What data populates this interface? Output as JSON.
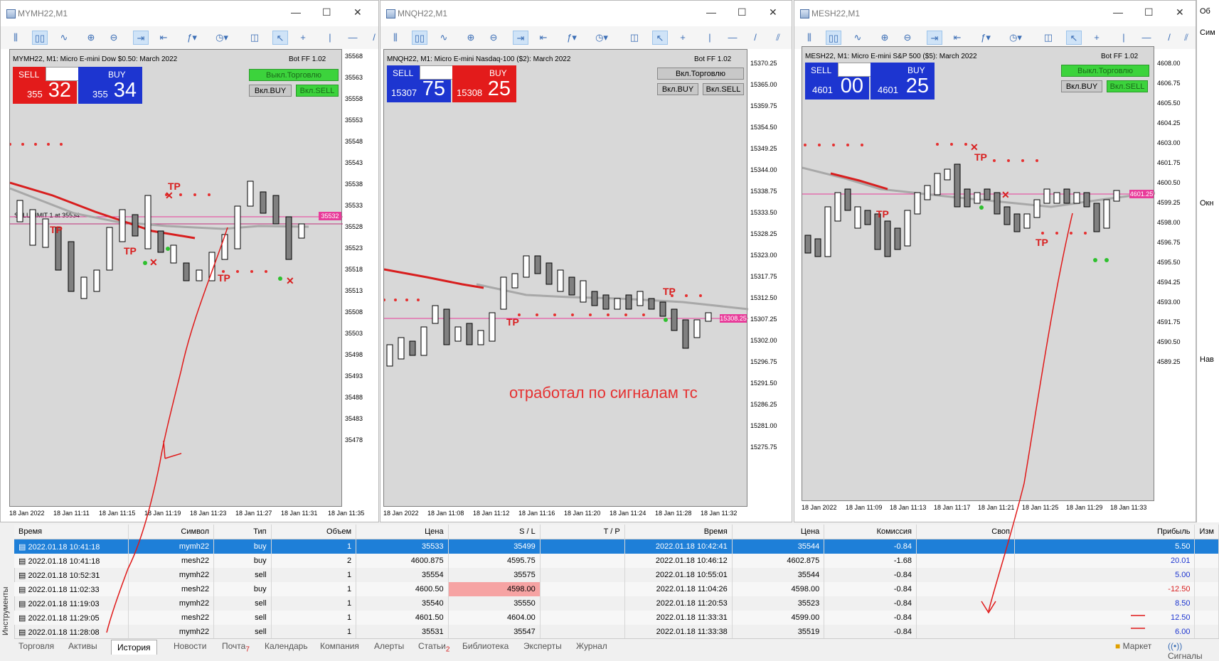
{
  "windows": [
    {
      "title": "MYMH22,M1",
      "header": "MYMH22, M1:  Micro E-mini Dow $0.50: March 2022",
      "bot": "Bot FF 1.02",
      "sell_label": "SELL",
      "buy_label": "BUY",
      "lot": "1",
      "sell_small": "355",
      "sell_big": "32",
      "buy_small": "355",
      "buy_big": "34",
      "btn_trade": "Выкл.Торговлю",
      "btn_buy": "Вкл.BUY",
      "btn_sell": "Вкл.SELL",
      "price_tag": "35532",
      "order_line": "SELL LIMIT 1 at 35534",
      "yticks": [
        "35568",
        "35563",
        "35558",
        "35553",
        "35548",
        "35543",
        "35538",
        "35533",
        "35528",
        "35523",
        "35518",
        "35513",
        "35508",
        "35503",
        "35498",
        "35493",
        "35488",
        "35483",
        "35478"
      ],
      "xticks": [
        "18 Jan 2022",
        "18 Jan 11:11",
        "18 Jan 11:15",
        "18 Jan 11:19",
        "18 Jan 11:23",
        "18 Jan 11:27",
        "18 Jan 11:31",
        "18 Jan 11:35"
      ]
    },
    {
      "title": "MNQH22,M1",
      "header": "MNQH22, M1:  Micro E-mini Nasdaq-100 ($2): March 2022",
      "bot": "Bot FF 1.02",
      "sell_label": "SELL",
      "buy_label": "BUY",
      "lot": "1",
      "sell_small": "15307",
      "sell_big": "75",
      "buy_small": "15308",
      "buy_big": "25",
      "btn_trade": "Вкл.Торговлю",
      "btn_buy": "Вкл.BUY",
      "btn_sell": "Вкл.SELL",
      "price_tag": "15308.25",
      "yticks": [
        "15370.25",
        "15365.00",
        "15359.75",
        "15354.50",
        "15349.25",
        "15344.00",
        "15338.75",
        "15333.50",
        "15328.25",
        "15323.00",
        "15317.75",
        "15312.50",
        "15307.25",
        "15302.00",
        "15296.75",
        "15291.50",
        "15286.25",
        "15281.00",
        "15275.75"
      ],
      "xticks": [
        "18 Jan 2022",
        "18 Jan 11:08",
        "18 Jan 11:12",
        "18 Jan 11:16",
        "18 Jan 11:20",
        "18 Jan 11:24",
        "18 Jan 11:28",
        "18 Jan 11:32"
      ]
    },
    {
      "title": "MESH22,M1",
      "header": "MESH22, M1:  Micro E-mini S&P 500 ($5): March 2022",
      "bot": "Bot FF 1.02",
      "sell_label": "SELL",
      "buy_label": "BUY",
      "lot": "1",
      "sell_small": "4601",
      "sell_big": "00",
      "buy_small": "4601",
      "buy_big": "25",
      "btn_trade": "Выкл.Торговлю",
      "btn_buy": "Вкл.BUY",
      "btn_sell": "Вкл.SELL",
      "price_tag": "4601.25",
      "yticks": [
        "4608.00",
        "4606.75",
        "4605.50",
        "4604.25",
        "4603.00",
        "4601.75",
        "4600.50",
        "4599.25",
        "4598.00",
        "4596.75",
        "4595.50",
        "4594.25",
        "4593.00",
        "4591.75",
        "4590.50",
        "4589.25"
      ],
      "xticks": [
        "18 Jan 2022",
        "18 Jan 11:09",
        "18 Jan 11:13",
        "18 Jan 11:17",
        "18 Jan 11:21",
        "18 Jan 11:25",
        "18 Jan 11:29",
        "18 Jan 11:33"
      ]
    }
  ],
  "annotation": "отработал по сигналам тс",
  "tp_label": "TP",
  "history": {
    "headers": [
      "Время",
      "Символ",
      "Тип",
      "Объем",
      "Цена",
      "S / L",
      "T / P",
      "Время",
      "Цена",
      "Комиссия",
      "Своп",
      "Прибыль",
      "Изм"
    ],
    "rows": [
      [
        "2022.01.18 10:41:18",
        "mymh22",
        "buy",
        "1",
        "35533",
        "35499",
        "",
        "2022.01.18 10:42:41",
        "35544",
        "-0.84",
        "",
        "5.50"
      ],
      [
        "2022.01.18 10:41:18",
        "mesh22",
        "buy",
        "2",
        "4600.875",
        "4595.75",
        "",
        "2022.01.18 10:46:12",
        "4602.875",
        "-1.68",
        "",
        "20.01"
      ],
      [
        "2022.01.18 10:52:31",
        "mymh22",
        "sell",
        "1",
        "35554",
        "35575",
        "",
        "2022.01.18 10:55:01",
        "35544",
        "-0.84",
        "",
        "5.00"
      ],
      [
        "2022.01.18 11:02:33",
        "mesh22",
        "buy",
        "1",
        "4600.50",
        "4598.00",
        "",
        "2022.01.18 11:04:26",
        "4598.00",
        "-0.84",
        "",
        "-12.50"
      ],
      [
        "2022.01.18 11:19:03",
        "mymh22",
        "sell",
        "1",
        "35540",
        "35550",
        "",
        "2022.01.18 11:20:53",
        "35523",
        "-0.84",
        "",
        "8.50"
      ],
      [
        "2022.01.18 11:29:05",
        "mesh22",
        "sell",
        "1",
        "4601.50",
        "4604.00",
        "",
        "2022.01.18 11:33:31",
        "4599.00",
        "-0.84",
        "",
        "12.50"
      ],
      [
        "2022.01.18 11:28:08",
        "mymh22",
        "sell",
        "1",
        "35531",
        "35547",
        "",
        "2022.01.18 11:33:38",
        "35519",
        "-0.84",
        "",
        "6.00"
      ]
    ]
  },
  "tabs": [
    "Торговля",
    "Активы",
    "История",
    "Новости",
    "Почта",
    "Календарь",
    "Компания",
    "Алерты",
    "Статьи",
    "Библиотека",
    "Эксперты",
    "Журнал"
  ],
  "tab_badges": {
    "mail": "7",
    "articles": "2"
  },
  "status": {
    "market": "Маркет",
    "signals": "Сигналы"
  },
  "side_label": "Инструменты",
  "right_panel": [
    "Сим",
    "Окн",
    "Нав",
    "Об"
  ]
}
